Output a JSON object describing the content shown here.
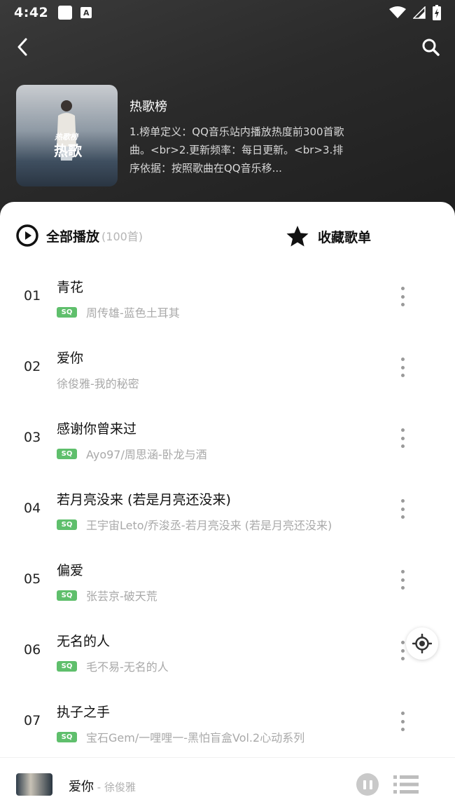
{
  "status_bar": {
    "time": "4:42",
    "notification_icon": "app-notification-icon",
    "accessibility_icon_text": "A",
    "icons": [
      "wifi-icon",
      "signal-icon",
      "battery-icon"
    ]
  },
  "toolbar": {
    "back_icon": "chevron-left-icon",
    "search_icon": "search-icon"
  },
  "playlist": {
    "cover_text_top": "热歌榜",
    "cover_text_main": "热歌",
    "title": "热歌榜",
    "description": "1.榜单定义：QQ音乐站内播放热度前300首歌曲。<br>2.更新频率：每日更新。<br>3.排序依据：按照歌曲在QQ音乐移..."
  },
  "actions": {
    "play_all_label": "全部播放",
    "play_all_count": "(100首)",
    "collect_label": "收藏歌单"
  },
  "songs": [
    {
      "index": "01",
      "name": "青花",
      "artist": "周传雄-蓝色土耳其",
      "sq": true
    },
    {
      "index": "02",
      "name": "爱你",
      "artist": "徐俊雅-我的秘密",
      "sq": false
    },
    {
      "index": "03",
      "name": "感谢你曾来过",
      "artist": "Ayo97/周思涵-卧龙与酒",
      "sq": true
    },
    {
      "index": "04",
      "name": "若月亮没来 (若是月亮还没来)",
      "artist": "王宇宙Leto/乔浚丞-若月亮没来 (若是月亮还没来)",
      "sq": true
    },
    {
      "index": "05",
      "name": "偏爱",
      "artist": "张芸京-破天荒",
      "sq": true
    },
    {
      "index": "06",
      "name": "无名的人",
      "artist": "毛不易-无名的人",
      "sq": true
    },
    {
      "index": "07",
      "name": "执子之手",
      "artist": "宝石Gem/一哩哩一-黑怕盲盒Vol.2心动系列",
      "sq": true
    }
  ],
  "sq_label": "SQ",
  "mini_player": {
    "title": "爱你",
    "artist": " - 徐俊雅"
  },
  "colors": {
    "sq_badge": "#5fbf6c",
    "header_bg": "#2a2a2a"
  }
}
